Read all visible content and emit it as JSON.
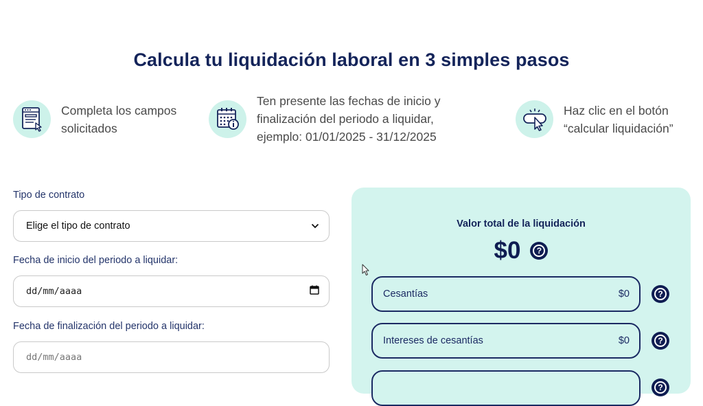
{
  "page": {
    "title": "Calcula tu liquidación laboral en 3 simples pasos"
  },
  "steps": [
    {
      "icon": "form-icon",
      "text_line1": "Completa los campos",
      "text_line2": "solicitados",
      "text_line3": ""
    },
    {
      "icon": "calendar-icon",
      "text_line1": "Ten presente las fechas de inicio y",
      "text_line2": "finalización del periodo a liquidar,",
      "text_line3": "ejemplo: 01/01/2025 - 31/12/2025"
    },
    {
      "icon": "click-icon",
      "text_line1": "Haz clic en el botón",
      "text_line2": "“calcular liquidación”",
      "text_line3": ""
    }
  ],
  "form": {
    "contract_type_label": "Tipo de contrato",
    "contract_type_value": "Elige el tipo de contrato",
    "start_date_label": "Fecha de inicio del periodo a liquidar:",
    "start_date_value": "dd/mm/aaaa",
    "end_date_label": "Fecha de finalización del periodo a liquidar:",
    "end_date_value": "dd/mm/aaaa"
  },
  "result": {
    "title": "Valor total de la liquidación",
    "total": "$0",
    "help_glyph": "?",
    "rows": [
      {
        "name": "Cesantías",
        "value": "$0"
      },
      {
        "name": "Intereses de cesantías",
        "value": "$0"
      },
      {
        "name": "",
        "value": ""
      }
    ]
  },
  "colors": {
    "brand_navy": "#14245a",
    "panel_mint": "#d3f4ee",
    "icon_circle": "#cdf2ea"
  }
}
